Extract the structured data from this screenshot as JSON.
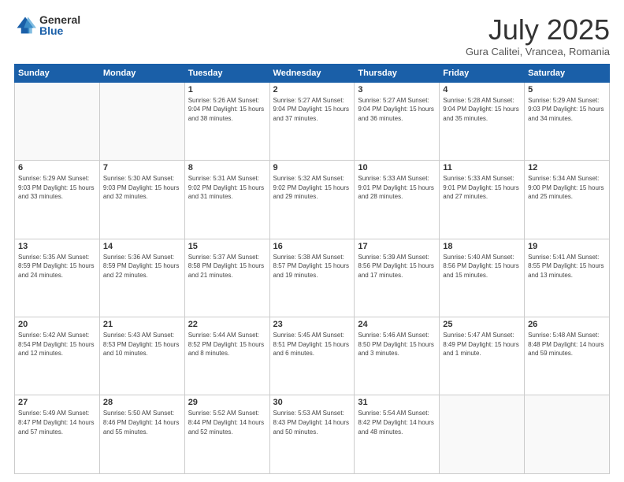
{
  "logo": {
    "general": "General",
    "blue": "Blue"
  },
  "header": {
    "title": "July 2025",
    "subtitle": "Gura Calitei, Vrancea, Romania"
  },
  "days_of_week": [
    "Sunday",
    "Monday",
    "Tuesday",
    "Wednesday",
    "Thursday",
    "Friday",
    "Saturday"
  ],
  "weeks": [
    [
      {
        "day": "",
        "info": ""
      },
      {
        "day": "",
        "info": ""
      },
      {
        "day": "1",
        "info": "Sunrise: 5:26 AM\nSunset: 9:04 PM\nDaylight: 15 hours\nand 38 minutes."
      },
      {
        "day": "2",
        "info": "Sunrise: 5:27 AM\nSunset: 9:04 PM\nDaylight: 15 hours\nand 37 minutes."
      },
      {
        "day": "3",
        "info": "Sunrise: 5:27 AM\nSunset: 9:04 PM\nDaylight: 15 hours\nand 36 minutes."
      },
      {
        "day": "4",
        "info": "Sunrise: 5:28 AM\nSunset: 9:04 PM\nDaylight: 15 hours\nand 35 minutes."
      },
      {
        "day": "5",
        "info": "Sunrise: 5:29 AM\nSunset: 9:03 PM\nDaylight: 15 hours\nand 34 minutes."
      }
    ],
    [
      {
        "day": "6",
        "info": "Sunrise: 5:29 AM\nSunset: 9:03 PM\nDaylight: 15 hours\nand 33 minutes."
      },
      {
        "day": "7",
        "info": "Sunrise: 5:30 AM\nSunset: 9:03 PM\nDaylight: 15 hours\nand 32 minutes."
      },
      {
        "day": "8",
        "info": "Sunrise: 5:31 AM\nSunset: 9:02 PM\nDaylight: 15 hours\nand 31 minutes."
      },
      {
        "day": "9",
        "info": "Sunrise: 5:32 AM\nSunset: 9:02 PM\nDaylight: 15 hours\nand 29 minutes."
      },
      {
        "day": "10",
        "info": "Sunrise: 5:33 AM\nSunset: 9:01 PM\nDaylight: 15 hours\nand 28 minutes."
      },
      {
        "day": "11",
        "info": "Sunrise: 5:33 AM\nSunset: 9:01 PM\nDaylight: 15 hours\nand 27 minutes."
      },
      {
        "day": "12",
        "info": "Sunrise: 5:34 AM\nSunset: 9:00 PM\nDaylight: 15 hours\nand 25 minutes."
      }
    ],
    [
      {
        "day": "13",
        "info": "Sunrise: 5:35 AM\nSunset: 8:59 PM\nDaylight: 15 hours\nand 24 minutes."
      },
      {
        "day": "14",
        "info": "Sunrise: 5:36 AM\nSunset: 8:59 PM\nDaylight: 15 hours\nand 22 minutes."
      },
      {
        "day": "15",
        "info": "Sunrise: 5:37 AM\nSunset: 8:58 PM\nDaylight: 15 hours\nand 21 minutes."
      },
      {
        "day": "16",
        "info": "Sunrise: 5:38 AM\nSunset: 8:57 PM\nDaylight: 15 hours\nand 19 minutes."
      },
      {
        "day": "17",
        "info": "Sunrise: 5:39 AM\nSunset: 8:56 PM\nDaylight: 15 hours\nand 17 minutes."
      },
      {
        "day": "18",
        "info": "Sunrise: 5:40 AM\nSunset: 8:56 PM\nDaylight: 15 hours\nand 15 minutes."
      },
      {
        "day": "19",
        "info": "Sunrise: 5:41 AM\nSunset: 8:55 PM\nDaylight: 15 hours\nand 13 minutes."
      }
    ],
    [
      {
        "day": "20",
        "info": "Sunrise: 5:42 AM\nSunset: 8:54 PM\nDaylight: 15 hours\nand 12 minutes."
      },
      {
        "day": "21",
        "info": "Sunrise: 5:43 AM\nSunset: 8:53 PM\nDaylight: 15 hours\nand 10 minutes."
      },
      {
        "day": "22",
        "info": "Sunrise: 5:44 AM\nSunset: 8:52 PM\nDaylight: 15 hours\nand 8 minutes."
      },
      {
        "day": "23",
        "info": "Sunrise: 5:45 AM\nSunset: 8:51 PM\nDaylight: 15 hours\nand 6 minutes."
      },
      {
        "day": "24",
        "info": "Sunrise: 5:46 AM\nSunset: 8:50 PM\nDaylight: 15 hours\nand 3 minutes."
      },
      {
        "day": "25",
        "info": "Sunrise: 5:47 AM\nSunset: 8:49 PM\nDaylight: 15 hours\nand 1 minute."
      },
      {
        "day": "26",
        "info": "Sunrise: 5:48 AM\nSunset: 8:48 PM\nDaylight: 14 hours\nand 59 minutes."
      }
    ],
    [
      {
        "day": "27",
        "info": "Sunrise: 5:49 AM\nSunset: 8:47 PM\nDaylight: 14 hours\nand 57 minutes."
      },
      {
        "day": "28",
        "info": "Sunrise: 5:50 AM\nSunset: 8:46 PM\nDaylight: 14 hours\nand 55 minutes."
      },
      {
        "day": "29",
        "info": "Sunrise: 5:52 AM\nSunset: 8:44 PM\nDaylight: 14 hours\nand 52 minutes."
      },
      {
        "day": "30",
        "info": "Sunrise: 5:53 AM\nSunset: 8:43 PM\nDaylight: 14 hours\nand 50 minutes."
      },
      {
        "day": "31",
        "info": "Sunrise: 5:54 AM\nSunset: 8:42 PM\nDaylight: 14 hours\nand 48 minutes."
      },
      {
        "day": "",
        "info": ""
      },
      {
        "day": "",
        "info": ""
      }
    ]
  ]
}
